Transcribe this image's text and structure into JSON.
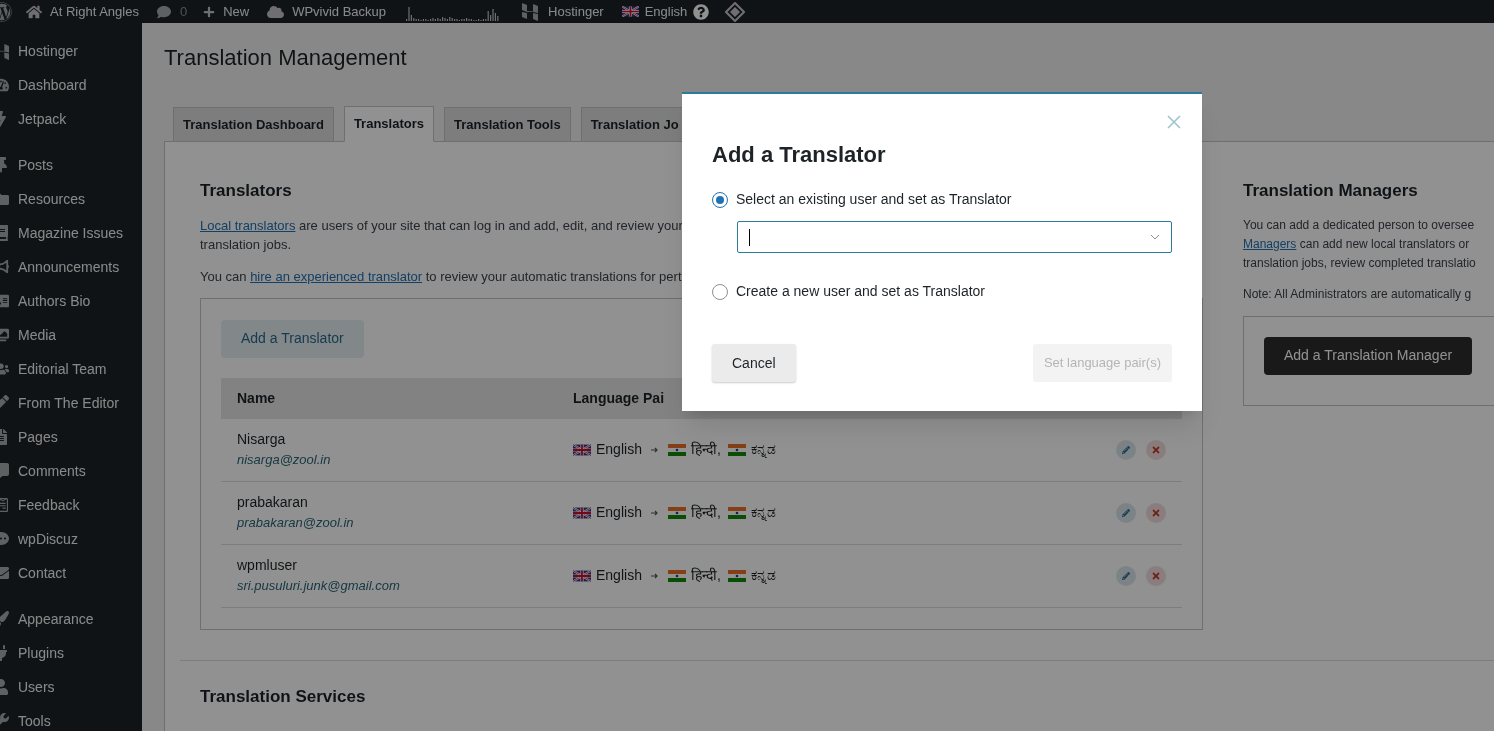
{
  "admin_bar": [
    {
      "kind": "wp-logo"
    },
    {
      "kind": "home",
      "label": "At Right Angles"
    },
    {
      "kind": "comments",
      "label": "0"
    },
    {
      "kind": "new",
      "label": "New"
    },
    {
      "kind": "cloud",
      "label": "WPvivid Backup"
    },
    {
      "kind": "sparkline"
    },
    {
      "kind": "hostinger",
      "label": "Hostinger"
    },
    {
      "kind": "language",
      "label": "English"
    },
    {
      "kind": "diamond"
    }
  ],
  "sidebar": {
    "groups": [
      [
        "Hostinger",
        "Dashboard",
        "Jetpack"
      ],
      [
        "Posts",
        "Resources",
        "Magazine Issues",
        "Announcements",
        "Authors Bio",
        "Media",
        "Editorial Team",
        "From The Editor",
        "Pages",
        "Comments",
        "Feedback",
        "wpDiscuz",
        "Contact"
      ],
      [
        "Appearance",
        "Plugins",
        "Users",
        "Tools"
      ]
    ]
  },
  "page_title": "Translation Management",
  "tabs": [
    {
      "label": "Translation Dashboard",
      "selected": false
    },
    {
      "label": "Translators",
      "selected": true
    },
    {
      "label": "Translation Tools",
      "selected": false
    },
    {
      "label": "Translation Jo",
      "selected": false
    }
  ],
  "translators": {
    "heading": "Translators",
    "intro": {
      "link": "Local translators",
      "text": " are users of your site that can log in and add, edit, and review your",
      "line2": "translation jobs."
    },
    "hire": {
      "before": "You can ",
      "link": "hire an experienced translator",
      "after": " to review your automatic translations for pert"
    },
    "add_button": "Add a Translator",
    "columns": [
      "Name",
      "Language Pai"
    ],
    "rows": [
      {
        "name": "Nisarga",
        "email": "nisarga@zool.in",
        "from": "English",
        "to": [
          "हिन्दी,",
          "ಕನ್ನಡ"
        ]
      },
      {
        "name": "prabakaran",
        "email": "prabakaran@zool.in",
        "from": "English",
        "to": [
          "हिन्दी,",
          "ಕನ್ನಡ"
        ]
      },
      {
        "name": "wpmluser",
        "email": "sri.pusuluri.junk@gmail.com",
        "from": "English",
        "to": [
          "हिन्दी,",
          "ಕನ್ನಡ"
        ]
      }
    ]
  },
  "services_heading": "Translation Services",
  "managers": {
    "heading": "Translation Managers",
    "line1": "You can add a dedicated person to oversee",
    "line2_link": "Managers",
    "line2": " can add new local translators or",
    "line3": "translation jobs, review completed translatio",
    "note": "Note: All Administrators are automatically g",
    "button": "Add a Translation Manager"
  },
  "dialog": {
    "title": "Add a Translator",
    "options": [
      {
        "label": "Select an existing user and set as Translator",
        "selected": true
      },
      {
        "label": "Create a new user and set as Translator",
        "selected": false
      }
    ],
    "cancel": "Cancel",
    "confirm": {
      "label": "Set language pair(s)",
      "disabled": true
    }
  }
}
